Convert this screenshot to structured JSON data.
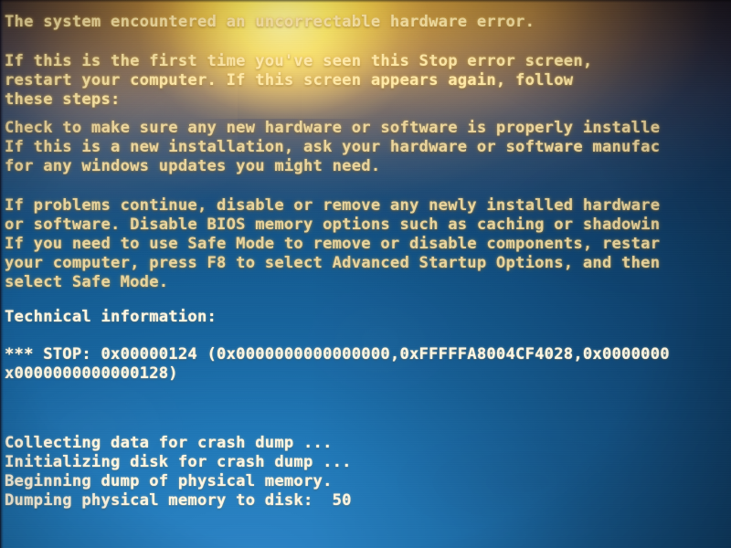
{
  "screen": {
    "kind": "windows-stop-error-blue-screen",
    "photo_of_monitor": true,
    "background_color": "#1f74b4",
    "text_color": "#f6edd2",
    "glare_color": "#ffc428",
    "glare_core_color": "#ffe278"
  },
  "message": {
    "headline": "The system encountered an uncorrectable hardware error.",
    "intro": [
      "If this is the first time you've seen this Stop error screen,",
      "restart your computer. If this screen appears again, follow",
      "these steps:"
    ],
    "paragraph_1": [
      "Check to make sure any new hardware or software is properly installe",
      "If this is a new installation, ask your hardware or software manufac",
      "for any windows updates you might need."
    ],
    "paragraph_2": [
      "If problems continue, disable or remove any newly installed hardware",
      "or software. Disable BIOS memory options such as caching or shadowin",
      "If you need to use Safe Mode to remove or disable components, restar",
      "your computer, press F8 to select Advanced Startup Options, and then",
      "select Safe Mode."
    ],
    "technical_heading": "Technical information:",
    "stop_lines": [
      "*** STOP: 0x00000124 (0x0000000000000000,0xFFFFFA8004CF4028,0x0000000",
      "x0000000000000128)"
    ],
    "stop_code": "0x00000124",
    "stop_parameters": [
      "0x0000000000000000",
      "0xFFFFFA8004CF4028",
      "0x00000000",
      "x0000000000000128"
    ],
    "dump_progress": [
      "Collecting data for crash dump ...",
      "Initializing disk for crash dump ...",
      "Beginning dump of physical memory.",
      "Dumping physical memory to disk:  50"
    ],
    "dump_percent": "50"
  }
}
